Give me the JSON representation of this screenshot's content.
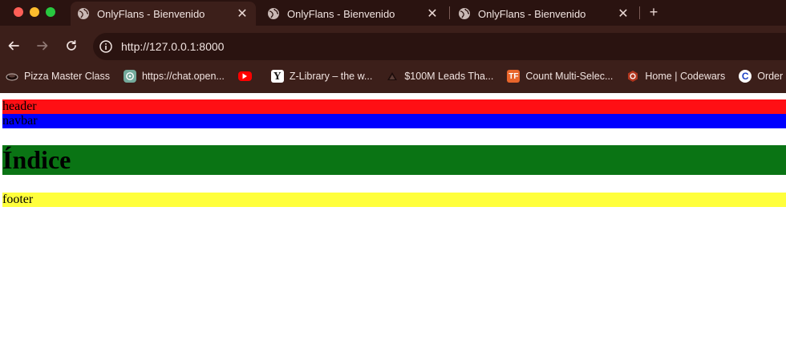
{
  "browser": {
    "tabs": [
      {
        "title": "OnlyFlans - Bienvenido",
        "active": true
      },
      {
        "title": "OnlyFlans - Bienvenido",
        "active": false
      },
      {
        "title": "OnlyFlans - Bienvenido",
        "active": false
      }
    ],
    "new_tab_icon": "plus-icon",
    "address_bar": {
      "url": "http://127.0.0.1:8000"
    },
    "bookmarks": [
      {
        "label": "Pizza Master Class",
        "icon": "pizza-icon"
      },
      {
        "label": "https://chat.open...",
        "icon": "chatgpt-icon"
      },
      {
        "label": "",
        "icon": "youtube-icon"
      },
      {
        "label": "Z-Library – the w...",
        "icon": "zlibrary-icon"
      },
      {
        "label": "$100M Leads Tha...",
        "icon": "triangle-icon"
      },
      {
        "label": "Count Multi-Selec...",
        "icon": "tf-icon"
      },
      {
        "label": "Home | Codewars",
        "icon": "codewars-icon"
      },
      {
        "label": "Order",
        "icon": "c-icon"
      }
    ]
  },
  "page": {
    "header": {
      "text": "header",
      "color": "#ff0f14"
    },
    "navbar": {
      "text": "navbar",
      "color": "#0000ff"
    },
    "index": {
      "text": "Índice",
      "color": "#0a7414"
    },
    "footer": {
      "text": "footer",
      "color": "#ffff3c"
    }
  },
  "colors": {
    "chrome_bg": "#3c1f1a",
    "tabstrip_bg": "#2a1310",
    "chrome_text": "#f1e4e1"
  }
}
